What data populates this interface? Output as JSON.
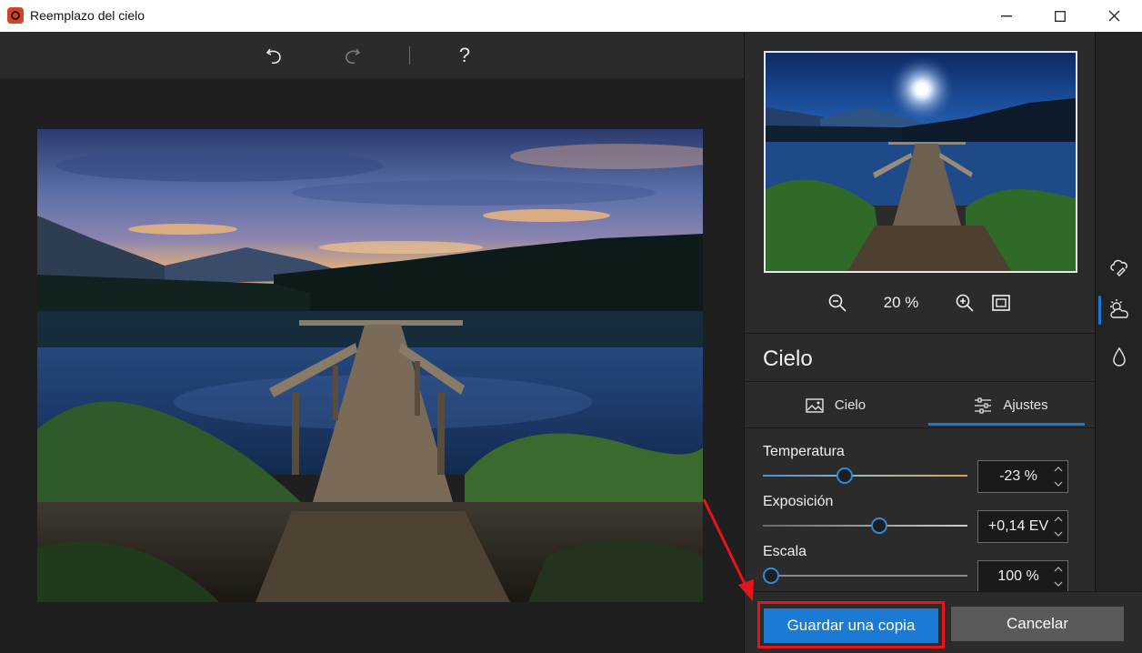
{
  "window": {
    "title": "Reemplazo del cielo"
  },
  "toolbar": {
    "undo_icon": "undo-icon",
    "redo_icon": "redo-icon",
    "help_label": "?"
  },
  "preview": {
    "zoom_value": "20 %",
    "zoom_out_icon": "zoom-out-icon",
    "zoom_in_icon": "zoom-in-icon",
    "fit_icon": "fit-to-screen-icon"
  },
  "panel": {
    "section_title": "Cielo",
    "tabs": [
      {
        "label": "Cielo",
        "icon": "image-icon",
        "selected": false
      },
      {
        "label": "Ajustes",
        "icon": "sliders-icon",
        "selected": true
      }
    ],
    "adjustments": [
      {
        "label": "Temperatura",
        "value": "-23 %",
        "position": 0.4
      },
      {
        "label": "Exposición",
        "value": "+0,14 EV",
        "position": 0.57
      },
      {
        "label": "Escala",
        "value": "100 %",
        "position": 0.0
      }
    ]
  },
  "rail": {
    "items": [
      {
        "icon": "sky-brush-icon",
        "active": false
      },
      {
        "icon": "partly-cloudy-icon",
        "active": true
      },
      {
        "icon": "water-drop-icon",
        "active": false
      }
    ]
  },
  "actions": {
    "save_label": "Guardar una copia",
    "cancel_label": "Cancelar"
  },
  "colors": {
    "accent": "#1a7ad4",
    "highlight": "#e8141a"
  }
}
